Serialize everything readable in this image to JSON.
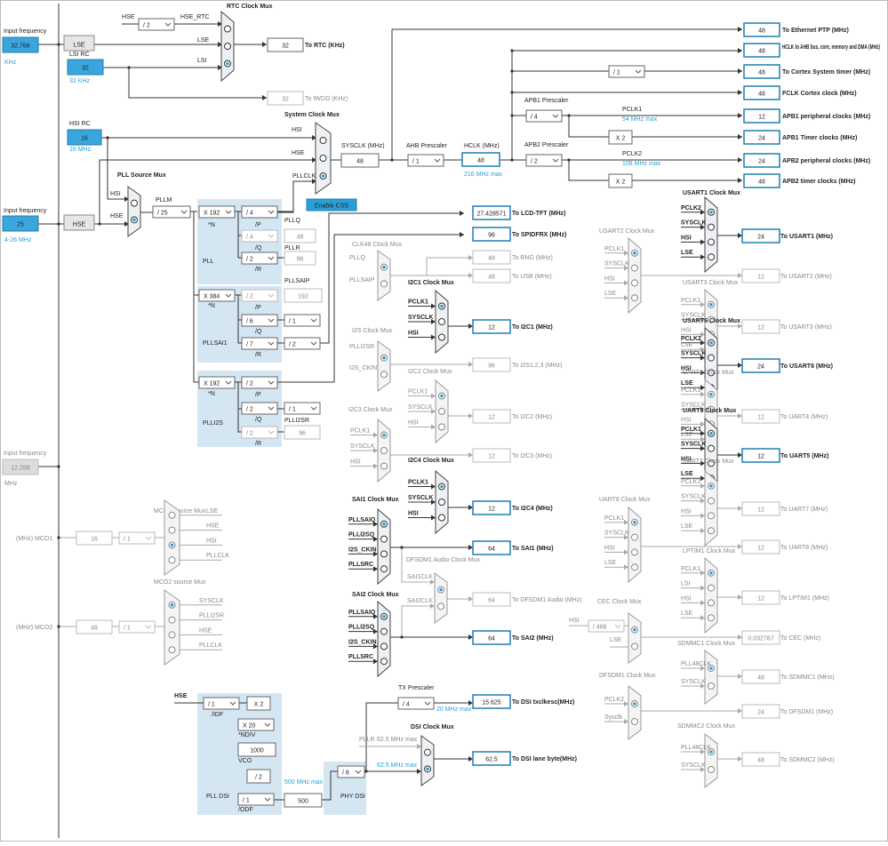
{
  "colors": {
    "accent": "#2a9fd6",
    "field_bg": "#3aa6dd",
    "panel_bg": "#d5e6f3",
    "box_border": "#1f7fb0"
  },
  "inputs": {
    "lse_label": "Input frequency",
    "lse_value": "32.768",
    "lse_unit": "KHz",
    "lse_name": "LSE",
    "lsirc_label": "LSI RC",
    "lsi_value": "32",
    "lsi_unit": "32 KHz",
    "hsirc_label": "HSI RC",
    "hsi_value": "16",
    "hsi_unit": "16 MHz",
    "hse_label": "Input frequency",
    "hse_value": "25",
    "hse_range": "4-26 MHz",
    "hse_name": "HSE",
    "ext_label": "Input frequency",
    "ext_value": "12.288",
    "ext_unit": "MHz"
  },
  "rtc": {
    "title": "RTC Clock Mux",
    "hse_in": "HSE",
    "div": "/ 2",
    "hse_rtc": "HSE_RTC",
    "lse": "LSE",
    "lsi": "LSI",
    "out_value": "32",
    "out_label": "To RTC (KHz)",
    "iwdg_value": "32",
    "iwdg_label": "To IWDG (KHz)"
  },
  "sysmux": {
    "title": "System Clock Mux",
    "hsi": "HSI",
    "hse": "HSE",
    "pllclk": "PLLCLK",
    "css_button": "Enable CSS"
  },
  "pllsrc": {
    "title": "PLL Source Mux",
    "hsi": "HSI",
    "hse": "HSE",
    "pllm_label": "PLLM",
    "pllm_value": "/ 25"
  },
  "pll": {
    "title": "PLL",
    "n_value": "X 192",
    "n_label": "*N",
    "p_value": "/ 4",
    "p_label": "/P",
    "q_value": "/ 4",
    "q_label": "/Q",
    "q_out": "48",
    "q_name": "PLLQ",
    "r_value": "/ 2",
    "r_label": "/R",
    "r_out": "96",
    "r_name": "PLLR"
  },
  "pllsai": {
    "title": "PLLSAI1",
    "n_value": "X 384",
    "n_label": "*N",
    "p_value": "/ 2",
    "p_label": "/P",
    "p_name": "PLLSAIP",
    "p_out": "192",
    "q_value": "/ 6",
    "q_label": "/Q",
    "q2_value": "/ 1",
    "r_value": "/ 7",
    "r_label": "/R",
    "r2_value": "/ 2"
  },
  "plli2s": {
    "title": "PLLI2S",
    "n_value": "X 192",
    "n_label": "*N",
    "p_value": "/ 2",
    "p_label": "/P",
    "q_value": "/ 2",
    "q_label": "/Q",
    "q2_value": "/ 1",
    "q_name": "PLLI2SR",
    "r_value": "/ 2",
    "r_label": "/R",
    "r_out": "96"
  },
  "sysclk": {
    "label": "SYSCLK (MHz)",
    "value": "48",
    "ahb_label": "AHB Prescaler",
    "ahb_value": "/ 1",
    "hclk_label": "HCLK (MHz)",
    "hclk_value": "48",
    "hclk_max": "216 MHz max"
  },
  "apb1": {
    "label": "APB1 Prescaler",
    "value": "/ 4",
    "pclk_label": "PCLK1",
    "pclk_max": "54 MHz max",
    "x2": "X 2"
  },
  "apb2": {
    "label": "APB2 Prescaler",
    "value": "/ 2",
    "pclk_label": "PCLK2",
    "pclk_max": "108 MHz max",
    "x2": "X 2"
  },
  "cortex_div": "/ 1",
  "outputs": [
    {
      "value": "48",
      "label": "To Ethernet PTP (MHz)"
    },
    {
      "value": "48",
      "label": "HCLK to AHB bus, core, memory and DMA (MHz)"
    },
    {
      "value": "48",
      "label": "To Cortex System timer (MHz)"
    },
    {
      "value": "48",
      "label": "FCLK Cortex clock (MHz)"
    },
    {
      "value": "12",
      "label": "APB1 peripheral clocks (MHz)"
    },
    {
      "value": "24",
      "label": "APB1 Timer clocks (MHz)"
    },
    {
      "value": "24",
      "label": "APB2 peripheral clocks (MHz)"
    },
    {
      "value": "48",
      "label": "APB2 timer clocks (MHz)"
    }
  ],
  "lcd": {
    "value": "27.428571",
    "label": "To LCD-TFT (MHz)"
  },
  "spdif": {
    "value": "96",
    "label": "To SPIDFRX (MHz)"
  },
  "clk48": {
    "title": "CLK48 Clock Mux",
    "in1": "PLLQ",
    "in2": "PLLSAIP",
    "rng_value": "48",
    "rng_label": "To RNG (MHz)",
    "usb_value": "48",
    "usb_label": "To USB (MHz)"
  },
  "i2c1": {
    "title": "I2C1 Clock Mux",
    "in1": "PCLK1",
    "in2": "SYSCLK",
    "in3": "HSI",
    "value": "12",
    "label": "To I2C1 (MHz)"
  },
  "i2s": {
    "title": "I2S Clock Mux",
    "in1": "PLLI2SR",
    "in2": "I2S_CKIN",
    "value": "96",
    "label": "To I2S1,2,3 (MHz)"
  },
  "i2c2": {
    "title": "I2C2 Clock Mux",
    "in1": "PCLK1",
    "in2": "SYSCLK",
    "in3": "HSI",
    "value": "12",
    "label": "To I2C2 (MHz)"
  },
  "i2c3": {
    "title": "I2C3 Clock Mux",
    "in1": "PCLK1",
    "in2": "SYSCLK",
    "in3": "HSI",
    "value": "12",
    "label": "To I2C3 (MHz)"
  },
  "i2c4": {
    "title": "I2C4 Clock Mux",
    "in1": "PCLK1",
    "in2": "SYSCLK",
    "in3": "HSI",
    "value": "12",
    "label": "To I2C4 (MHz)"
  },
  "sai1": {
    "title": "SAI1 Clock Mux",
    "in1": "PLLSAIQ",
    "in2": "PLLI2SQ",
    "in3": "I2S_CKIN",
    "in4": "PLLSRC",
    "value": "64",
    "label": "To SAI1 (MHz)"
  },
  "dfsdm1a": {
    "title": "DFSDM1 Audio Clock Mux",
    "in1": "SAI1CLK",
    "in2": "SAI2CLK",
    "value": "64",
    "label": "To DFSDM1 Audio (MHz)"
  },
  "sai2": {
    "title": "SAI2 Clock Mux",
    "in1": "PLLSAIQ",
    "in2": "PLLI2SQ",
    "in3": "I2S_CKIN",
    "in4": "PLLSRC",
    "value": "64",
    "label": "To SAI2 (MHz)"
  },
  "mco1": {
    "title": "MCO1 source Mux",
    "in1": "LSE",
    "in2": "HSE",
    "in3": "HSI",
    "in4": "PLLCLK",
    "label": "(MHz) MCO1",
    "value": "16",
    "div": "/ 1"
  },
  "mco2": {
    "title": "MCO2 source Mux",
    "in1": "SYSCLK",
    "in2": "PLLI2SR",
    "in3": "HSE",
    "in4": "PLLCLK",
    "label": "(MHz) MCO2",
    "value": "48",
    "div": "/ 1"
  },
  "plldsi": {
    "title": "PLL DSI",
    "hse": "HSE",
    "idf_value": "/ 1",
    "idf_label": "/IDF",
    "x2": "X 2",
    "ndiv_value": "X 20",
    "ndiv_label": "*NDIV",
    "vco_value": "1000",
    "vco_label": "VCO",
    "div2": "/ 2",
    "odf_value": "/ 1",
    "odf_label": "/ODF",
    "max": "500 MHz max",
    "out_value": "500",
    "phy_label": "PHY DSI",
    "phy_div": "/ 8"
  },
  "dsi": {
    "tx_label": "TX Prescaler",
    "tx_value": "/ 4",
    "tx_max": "20 MHz max",
    "esc_value": "15.625",
    "esc_label": "To DSI txclkesc(MHz)",
    "mux_title": "DSI Clock Mux",
    "pllr_label": "PLLR",
    "pllr_max": "62.5 MHz max",
    "phy_max": "62.5 MHz max",
    "lane_value": "62.5",
    "lane_label": "To DSI lane byte(MHz)"
  },
  "usart1": {
    "title": "USART1 Clock Mux",
    "in1": "PCLK2",
    "in2": "SYSCLK",
    "in3": "HSI",
    "in4": "LSE",
    "value": "24",
    "label": "To USART1 (MHz)"
  },
  "usart2": {
    "title": "USART2 Clock Mux",
    "in1": "PCLK1",
    "in2": "SYSCLK",
    "in3": "HSI",
    "in4": "LSE",
    "value": "12",
    "label": "To USART2 (MHz)"
  },
  "usart3": {
    "title": "USART3 Clock Mux",
    "in1": "PCLK1",
    "in2": "SYSCLK",
    "in3": "HSI",
    "in4": "LSE",
    "value": "12",
    "label": "To USART3 (MHz)"
  },
  "usart6": {
    "title": "USART6 Clock Mux",
    "in1": "PCLK2",
    "in2": "SYSCLK",
    "in3": "HSI",
    "in4": "LSE",
    "value": "24",
    "label": "To USART6 (MHz)"
  },
  "uart4": {
    "title": "UART4 Clock Mux",
    "in1": "PCLK1",
    "in2": "SYSCLK",
    "in3": "HSI",
    "in4": "LSE",
    "value": "12",
    "label": "To UART4 (MHz)"
  },
  "uart5": {
    "title": "UART5 Clock Mux",
    "in1": "PCLK1",
    "in2": "SYSCLK",
    "in3": "HSI",
    "in4": "LSE",
    "value": "12",
    "label": "To UART5 (MHz)"
  },
  "uart7": {
    "title": "UART7 Clock Mux",
    "in1": "PCLK1",
    "in2": "SYSCLK",
    "in3": "HSI",
    "in4": "LSE",
    "value": "12",
    "label": "To UART7 (MHz)"
  },
  "uart8": {
    "title": "UART8 Clock Mux",
    "in1": "PCLK1",
    "in2": "SYSCLK",
    "in3": "HSI",
    "in4": "LSE",
    "value": "12",
    "label": "To UART8 (MHz)"
  },
  "lptim1": {
    "title": "LPTIM1 Clock Mux",
    "in1": "PCLK1",
    "in2": "LSI",
    "in3": "HSI",
    "in4": "LSE",
    "value": "12",
    "label": "To LPTIM1 (MHz)"
  },
  "cec": {
    "title": "CEC Clock Mux",
    "hsi": "HSI",
    "div": "/ 488",
    "lse": "LSE",
    "value": "0.032787",
    "label": "To CEC (MHz)"
  },
  "sdmmc1": {
    "title": "SDMMC1 Clock Mux",
    "in1": "PLL48CLK",
    "in2": "SYSCLK",
    "value": "48",
    "label": "To SDMMC1 (MHz)"
  },
  "dfsdm1": {
    "title": "DFSDM1 Clock Mux",
    "in1": "PCLK2",
    "in2": "Sysclk",
    "value": "24",
    "label": "To DFSDM1 (MHz)"
  },
  "sdmmc2": {
    "title": "SDMMC2 Clock Mux",
    "in1": "PLL48CLK",
    "in2": "SYSCLK",
    "value": "48",
    "label": "To SDMMC2 (MHz)"
  }
}
